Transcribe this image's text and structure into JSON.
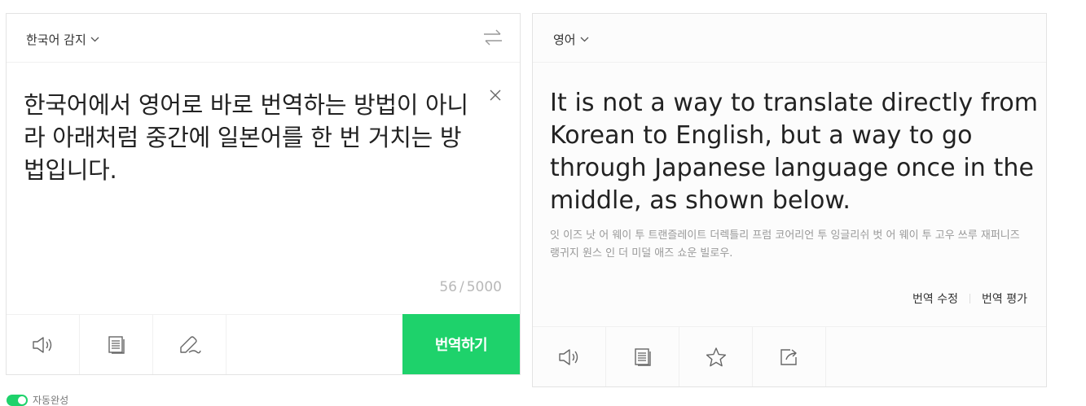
{
  "source": {
    "language_label": "한국어 감지",
    "text": "한국어에서 영어로 바로 번역하는 방법이 아니라 아래처럼 중간에 일본어를 한 번 거치는 방법입니다.",
    "char_count": "56",
    "char_separator": "/",
    "char_limit": "5000",
    "translate_button": "번역하기",
    "toolbar_icons": [
      "speaker-icon",
      "copy-icon",
      "handwriting-icon"
    ]
  },
  "target": {
    "language_label": "영어",
    "text": "It is not a way to translate directly from Korean to English, but a way to go through Japanese language once in the middle, as shown below.",
    "pronunciation": "잇 이즈 낫 어 웨이 투 트랜즐레이트 더렉틀리 프럼 코어리언 투 잉글리쉬 벗 어 웨이 투 고우 쓰루 재퍼니즈 랭귀지 원스 인 더 미덜 애즈 쇼운 빌로우.",
    "edit_label": "번역 수정",
    "rate_label": "번역 평가",
    "toolbar_icons": [
      "speaker-icon",
      "copy-icon",
      "star-icon",
      "share-icon"
    ]
  },
  "autocomplete": {
    "label": "자동완성",
    "enabled": true
  },
  "colors": {
    "accent": "#1ed26b",
    "muted_text": "#999999",
    "border": "#e3e3e3"
  }
}
